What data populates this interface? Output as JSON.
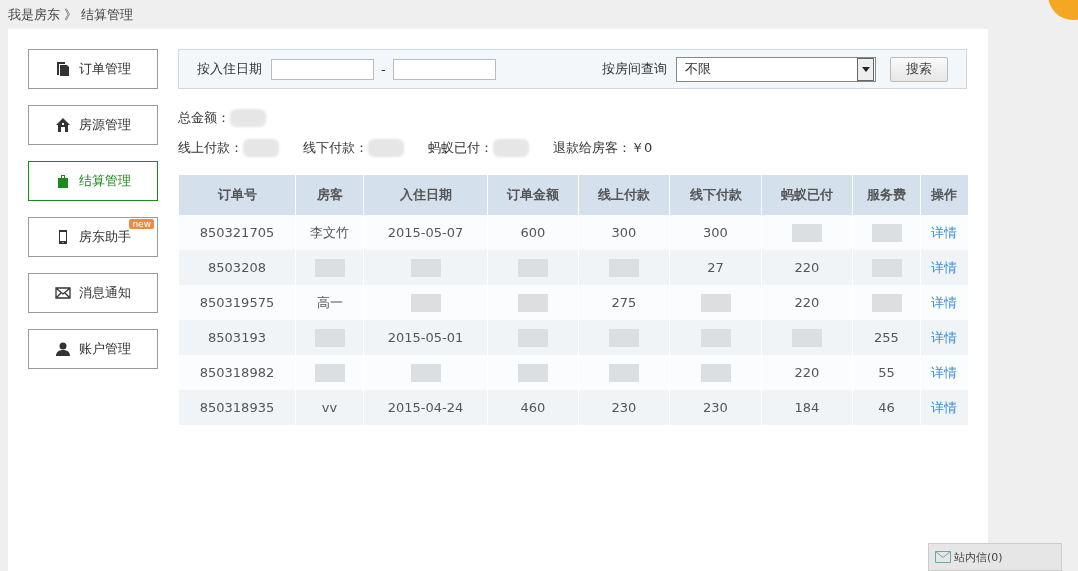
{
  "breadcrumb": {
    "items": [
      "我是房东",
      "结算管理"
    ],
    "separator": "》"
  },
  "sidebar": {
    "items": [
      {
        "label": "订单管理",
        "selected": false
      },
      {
        "label": "房源管理",
        "selected": false
      },
      {
        "label": "结算管理",
        "selected": true
      },
      {
        "label": "房东助手",
        "selected": false,
        "badge": "new"
      },
      {
        "label": "消息通知",
        "selected": false
      },
      {
        "label": "账户管理",
        "selected": false
      }
    ]
  },
  "filter": {
    "date_label": "按入住日期",
    "date_separator": "-",
    "room_label": "按房间查询",
    "room_value": "不限",
    "search_button": "搜索"
  },
  "summary": [
    [
      {
        "label": "总金额："
      }
    ],
    [
      {
        "label": "线上付款："
      },
      {
        "label": "线下付款："
      },
      {
        "label": "蚂蚁已付："
      },
      {
        "label": "退款给房客：",
        "value": "￥0"
      }
    ]
  ],
  "table": {
    "columns": [
      "订单号",
      "房客",
      "入住日期",
      "订单金额",
      "线上付款",
      "线下付款",
      "蚂蚁已付",
      "服务费",
      "操作"
    ],
    "rows": [
      {
        "cells": [
          "850321705",
          "李文竹",
          "2015-05-07",
          "600",
          "300",
          "300",
          null,
          null
        ],
        "action": "详情"
      },
      {
        "cells": [
          "8503208",
          null,
          null,
          null,
          null,
          "27",
          "220",
          null
        ],
        "action": "详情"
      },
      {
        "cells": [
          "850319575",
          "高一",
          null,
          null,
          "275",
          null,
          "220",
          null
        ],
        "action": "详情"
      },
      {
        "cells": [
          "8503193",
          null,
          "2015-05-01",
          null,
          null,
          null,
          null,
          "255"
        ],
        "action": "详情"
      },
      {
        "cells": [
          "850318982",
          null,
          null,
          null,
          null,
          null,
          "220",
          "55"
        ],
        "action": "详情"
      },
      {
        "cells": [
          "850318935",
          "vv",
          "2015-04-24",
          "460",
          "230",
          "230",
          "184",
          "46"
        ],
        "action": "详情"
      }
    ]
  },
  "inbox": {
    "label": "站内信(0)"
  }
}
